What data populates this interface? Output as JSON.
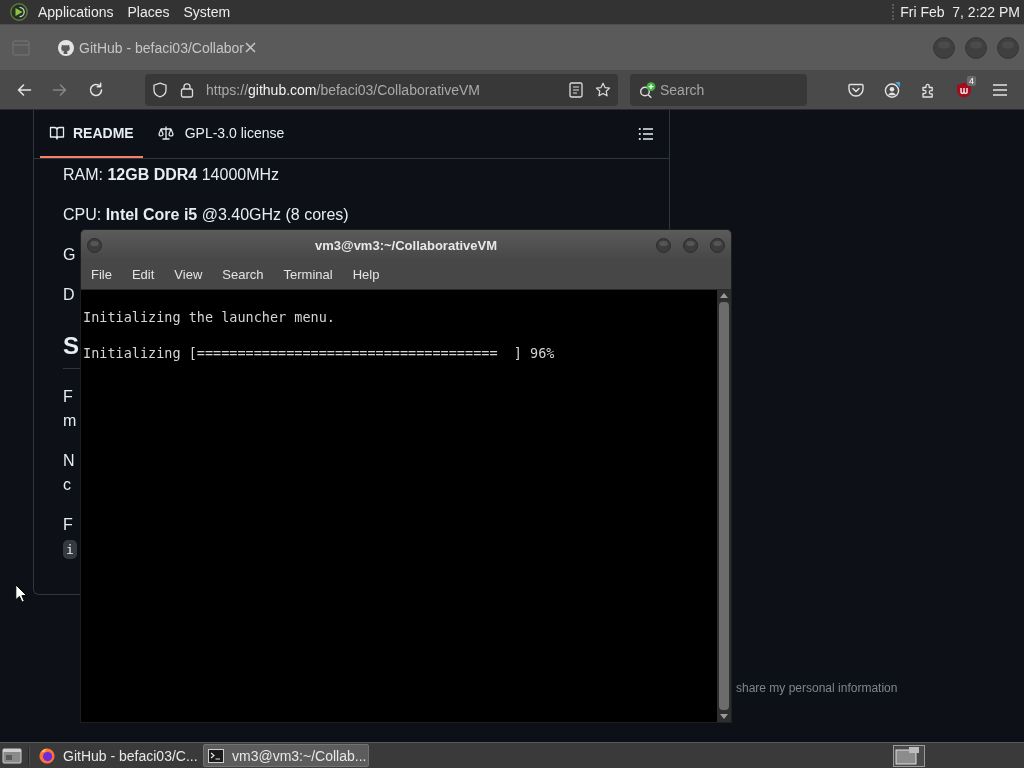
{
  "top_panel": {
    "menus": [
      "Applications",
      "Places",
      "System"
    ],
    "clock": "Fri Feb  7, 2:22 PM"
  },
  "browser": {
    "tab": {
      "title": "GitHub - befaci03/Collabor"
    },
    "nav": {
      "back": {
        "disabled": false
      },
      "forward": {
        "disabled": true
      }
    },
    "address": {
      "scheme": "https://",
      "host": "github.com",
      "path": "/befaci03/CollaborativeVM"
    },
    "search": {
      "placeholder": "Search"
    },
    "extension_badge": "4"
  },
  "readme": {
    "tabs": [
      {
        "label": "README",
        "selected": true
      },
      {
        "label": "GPL-3.0 license",
        "selected": false
      }
    ],
    "blocks": [
      {
        "kind": "paragraph",
        "lines": [
          "RAM: **12GB DDR4** 14000MHz"
        ]
      },
      {
        "kind": "paragraph",
        "lines": [
          "CPU: **Intel Core i5** @3.40GHz (8 cores)"
        ]
      },
      {
        "kind": "paragraph",
        "lines": [
          "G"
        ]
      },
      {
        "kind": "paragraph",
        "lines": [
          "D"
        ]
      },
      {
        "kind": "heading",
        "lines": [
          "S"
        ]
      },
      {
        "kind": "paragraph",
        "lines": [
          "F",
          "m"
        ]
      },
      {
        "kind": "paragraph",
        "lines": [
          "N",
          "c"
        ]
      },
      {
        "kind": "paragraph",
        "lines": [
          "F"
        ],
        "code": "i"
      }
    ]
  },
  "page_footer": {
    "link": "share my personal information"
  },
  "terminal": {
    "title": "vm3@vm3:~/CollaborativeVM",
    "menus": [
      "File",
      "Edit",
      "View",
      "Search",
      "Terminal",
      "Help"
    ],
    "lines": [
      "Initializing the launcher menu.",
      "Initializing [=====================================  ] 96%"
    ]
  },
  "taskbar": {
    "tasks": [
      {
        "kind": "browser",
        "title": "GitHub - befaci03/C...",
        "selected": false
      },
      {
        "kind": "terminal",
        "title": "vm3@vm3:~/Collab...",
        "selected": true
      }
    ]
  }
}
